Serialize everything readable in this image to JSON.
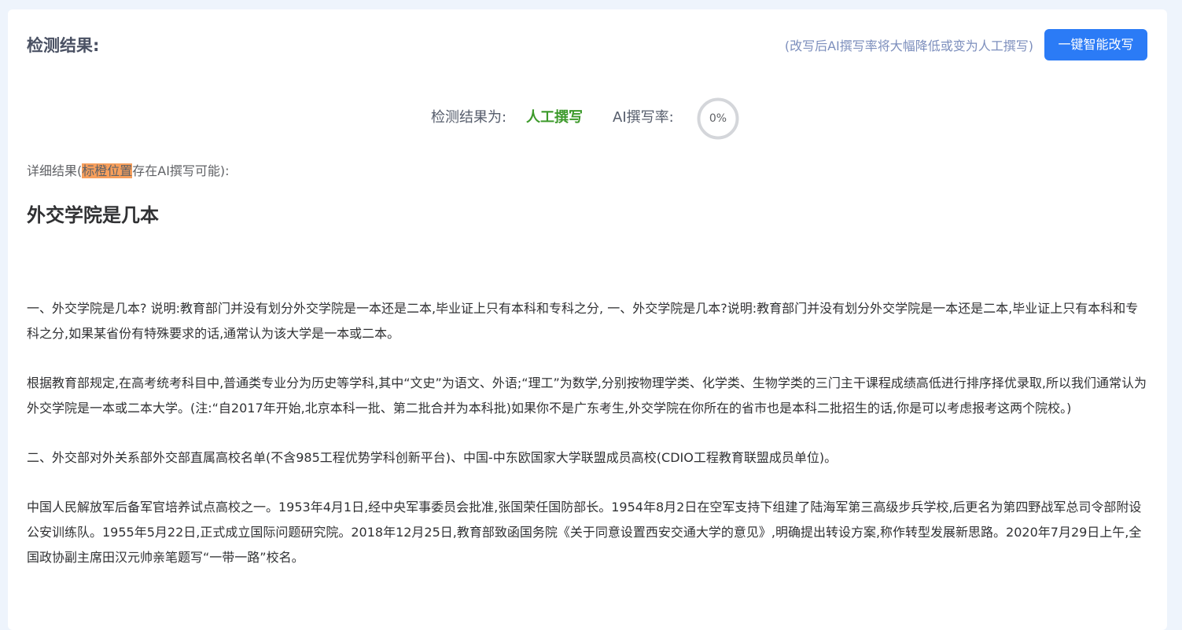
{
  "header": {
    "title": "检测结果:",
    "note": "(改写后AI撰写率将大幅降低或变为人工撰写)",
    "rewrite_button": "一键智能改写"
  },
  "result": {
    "label": "检测结果为:",
    "value": "人工撰写",
    "rate_label": "AI撰写率:",
    "rate_text": "0%",
    "rate_value": 0
  },
  "detail": {
    "prefix": "详细结果(",
    "highlight": "标橙位置",
    "suffix": "存在AI撰写可能):"
  },
  "document": {
    "title": "外交学院是几本",
    "paragraphs": [
      "一、外交学院是几本? 说明:教育部门并没有划分外交学院是一本还是二本,毕业证上只有本科和专科之分, 一、外交学院是几本?说明:教育部门并没有划分外交学院是一本还是二本,毕业证上只有本科和专科之分,如果某省份有特殊要求的话,通常认为该大学是一本或二本。",
      "根据教育部规定,在高考统考科目中,普通类专业分为历史等学科,其中“文史”为语文、外语;“理工”为数学,分别按物理学类、化学类、生物学类的三门主干课程成绩高低进行排序择优录取,所以我们通常认为外交学院是一本或二本大学。(注:“自2017年开始,北京本科一批、第二批合并为本科批)如果你不是广东考生,外交学院在你所在的省市也是本科二批招生的话,你是可以考虑报考这两个院校。)",
      "二、外交部对外关系部外交部直属高校名单(不含985工程优势学科创新平台)、中国-中东欧国家大学联盟成员高校(CDIO工程教育联盟成员单位)。",
      "中国人民解放军后备军官培养试点高校之一。1953年4月1日,经中央军事委员会批准,张国荣任国防部长。1954年8月2日在空军支持下组建了陆海军第三高级步兵学校,后更名为第四野战军总司令部附设公安训练队。1955年5月22日,正式成立国际问题研究院。2018年12月25日,教育部致函国务院《关于同意设置西安交通大学的意见》,明确提出转设方案,称作转型发展新思路。2020年7月29日上午,全国政协副主席田汉元帅亲笔题写“一带一路”校名。"
    ]
  },
  "colors": {
    "accent": "#2b7bf6",
    "human_result": "#3d9a2b",
    "highlight": "#f79f5c",
    "note": "#7d8fbd"
  }
}
